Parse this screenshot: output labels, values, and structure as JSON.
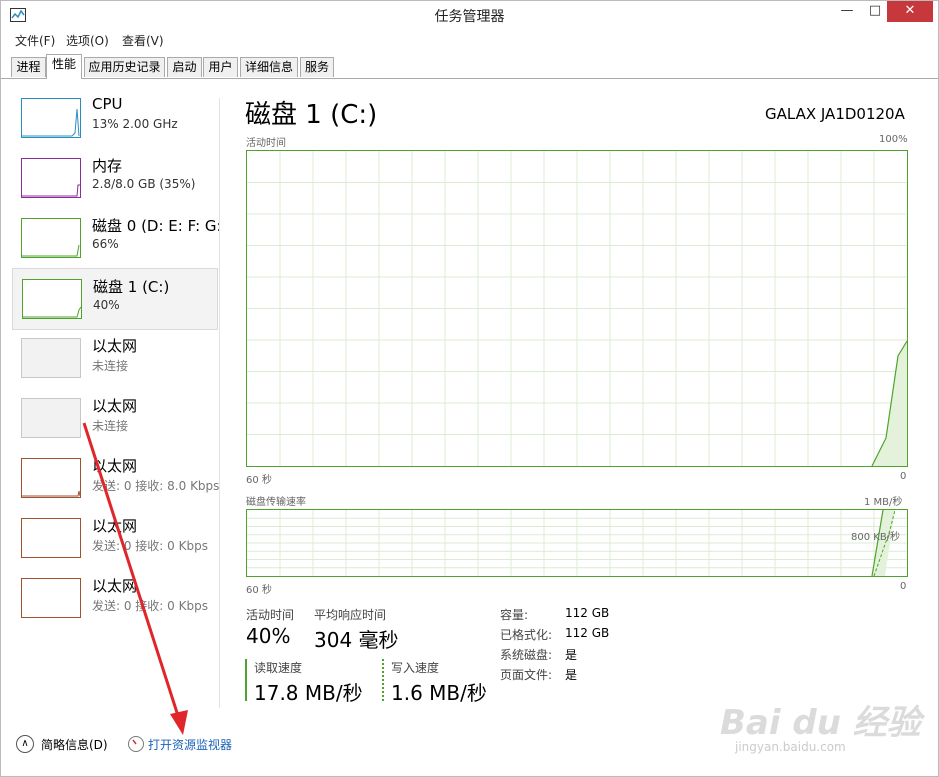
{
  "window": {
    "title": "任务管理器",
    "minimize": "—",
    "maximize": "□",
    "close": "✕"
  },
  "menu": [
    "文件(F)",
    "选项(O)",
    "查看(V)"
  ],
  "tabs": [
    "进程",
    "性能",
    "应用历史记录",
    "启动",
    "用户",
    "详细信息",
    "服务"
  ],
  "active_tab": 1,
  "resources": [
    {
      "name": "CPU",
      "sub": "13% 2.00 GHz",
      "kind": "cpu"
    },
    {
      "name": "内存",
      "sub": "2.8/8.0 GB (35%)",
      "kind": "mem"
    },
    {
      "name": "磁盘 0 (D: E: F: G:",
      "sub": "66%",
      "kind": "disk"
    },
    {
      "name": "磁盘 1 (C:)",
      "sub": "40%",
      "kind": "disk",
      "selected": true
    },
    {
      "name": "以太网",
      "sub": "未连接",
      "kind": "eth-off"
    },
    {
      "name": "以太网",
      "sub": "未连接",
      "kind": "eth-off"
    },
    {
      "name": "以太网",
      "sub": "发送: 0 接收: 8.0 Kbps",
      "kind": "eth"
    },
    {
      "name": "以太网",
      "sub": "发送: 0 接收: 0 Kbps",
      "kind": "eth"
    },
    {
      "name": "以太网",
      "sub": "发送: 0 接收: 0 Kbps",
      "kind": "eth"
    }
  ],
  "detail": {
    "title": "磁盘 1 (C:)",
    "model": "GALAX JA1D0120A",
    "graph1": {
      "label": "活动时间",
      "max": "100%",
      "left": "60 秒",
      "right": "0"
    },
    "graph2": {
      "label": "磁盘传输速率",
      "max": "1 MB/秒",
      "mid": "800 KB/秒",
      "left": "60 秒",
      "right": "0"
    },
    "active_time_label": "活动时间",
    "active_time": "40%",
    "response_label": "平均响应时间",
    "response": "304 毫秒",
    "read_label": "读取速度",
    "read": "17.8 MB/秒",
    "write_label": "写入速度",
    "write": "1.6 MB/秒",
    "info": [
      {
        "label": "容量:",
        "value": "112 GB"
      },
      {
        "label": "已格式化:",
        "value": "112 GB"
      },
      {
        "label": "系统磁盘:",
        "value": "是"
      },
      {
        "label": "页面文件:",
        "value": "是"
      }
    ]
  },
  "footer": {
    "fewer": "简略信息(D)",
    "monitor": "打开资源监视器"
  },
  "watermark": {
    "brand": "Bai du 经验",
    "url": "jingyan.baidu.com"
  },
  "colors": {
    "disk": "#4da32b",
    "cpu": "#2a8fc0",
    "mem": "#8c2a9c",
    "eth": "#a0522d",
    "link": "#1a63b8",
    "arrow": "#e0262a"
  }
}
